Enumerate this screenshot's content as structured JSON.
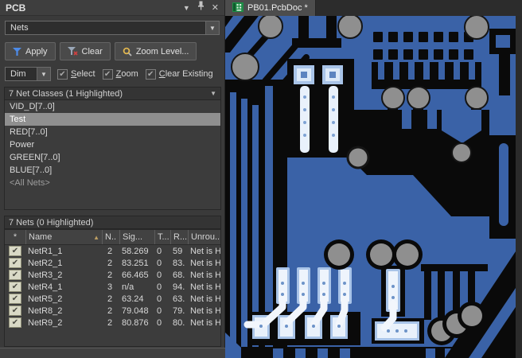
{
  "panel": {
    "title": "PCB",
    "mode_selector": {
      "value": "Nets"
    },
    "toolbar": {
      "apply_label": "Apply",
      "clear_label": "Clear",
      "zoom_level_label": "Zoom Level..."
    },
    "options": {
      "dim_label": "Dim",
      "checkboxes": [
        {
          "label": "Select",
          "checked": true
        },
        {
          "label": "Zoom",
          "checked": true
        },
        {
          "label": "Clear Existing",
          "checked": true
        }
      ]
    },
    "net_classes": {
      "header": "7 Net Classes (1 Highlighted)",
      "items": [
        {
          "label": "VID_D[7..0]",
          "highlighted": false
        },
        {
          "label": "Test",
          "highlighted": true
        },
        {
          "label": "RED[7..0]",
          "highlighted": false
        },
        {
          "label": "Power",
          "highlighted": false
        },
        {
          "label": "GREEN[7..0]",
          "highlighted": false
        },
        {
          "label": "BLUE[7..0]",
          "highlighted": false
        },
        {
          "label": "<All Nets>",
          "highlighted": false
        }
      ]
    },
    "nets": {
      "header": "7 Nets (0 Highlighted)",
      "columns": [
        "*",
        "Name",
        "N..",
        "Sig...",
        "T...",
        "R...",
        "Unrou..."
      ],
      "rows": [
        {
          "checked": true,
          "name": "NetR1_1",
          "nodes": "2",
          "signal": "58.269",
          "t": "0",
          "routed": "59",
          "unrouted": "Net is Hid"
        },
        {
          "checked": true,
          "name": "NetR2_1",
          "nodes": "2",
          "signal": "83.251",
          "t": "0",
          "routed": "83.",
          "unrouted": "Net is Hid"
        },
        {
          "checked": true,
          "name": "NetR3_2",
          "nodes": "2",
          "signal": "66.465",
          "t": "0",
          "routed": "68.",
          "unrouted": "Net is Hid"
        },
        {
          "checked": true,
          "name": "NetR4_1",
          "nodes": "3",
          "signal": "n/a",
          "t": "0",
          "routed": "94.",
          "unrouted": "Net is Hid"
        },
        {
          "checked": true,
          "name": "NetR5_2",
          "nodes": "2",
          "signal": "63.24",
          "t": "0",
          "routed": "63.",
          "unrouted": "Net is Hid"
        },
        {
          "checked": true,
          "name": "NetR8_2",
          "nodes": "2",
          "signal": "79.048",
          "t": "0",
          "routed": "79.",
          "unrouted": "Net is Hid"
        },
        {
          "checked": true,
          "name": "NetR9_2",
          "nodes": "2",
          "signal": "80.876",
          "t": "0",
          "routed": "80.",
          "unrouted": "Net is Hid"
        }
      ]
    }
  },
  "document": {
    "tab_label": "PB01.PcbDoc *"
  },
  "icons": {
    "dropdown_arrow": "▼",
    "close": "✕",
    "check": "✔",
    "sort_asc": "▲"
  },
  "colors": {
    "panel_bg": "#3a3a3a",
    "selection_bg": "#8f8f8f",
    "pcb_copper": "#3a62a7",
    "pcb_clearance": "#0a0a0a",
    "via_gray": "#8f8f8f",
    "highlight_pad": "#e9f1fb",
    "pad_outline": "#a9c4e8",
    "tab_active_bg": "#4d4d4d"
  }
}
